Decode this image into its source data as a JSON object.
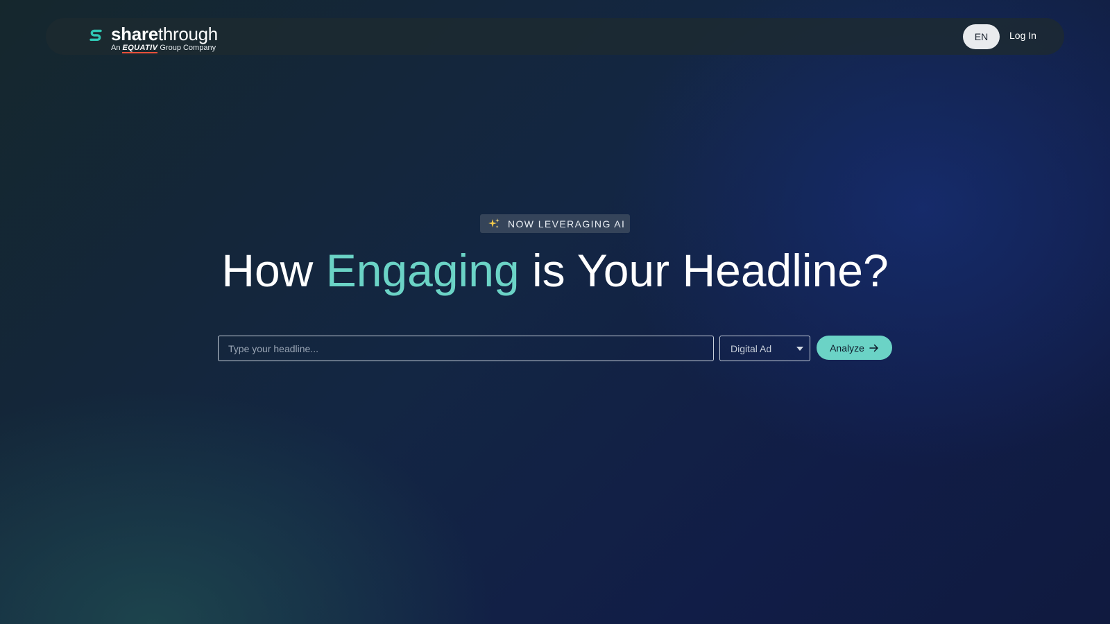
{
  "brand": {
    "name_bold": "share",
    "name_light": "through",
    "tag_prefix": "An",
    "tag_company": "EQUATIV",
    "tag_suffix": "Group Company",
    "logo_icon": "sharethrough-s-icon",
    "accent_color": "#2fc8b4"
  },
  "nav": {
    "language": "EN",
    "login": "Log In"
  },
  "badge": {
    "icon": "sparkles-icon",
    "text": "NOW LEVERAGING AI"
  },
  "hero": {
    "title_before": "How ",
    "title_accent": "Engaging",
    "title_after": " is Your Headline?",
    "accent_color": "#6bd3c6"
  },
  "form": {
    "headline_placeholder": "Type your headline...",
    "headline_value": "",
    "type_selected": "Digital Ad",
    "analyze_label": "Analyze",
    "analyze_icon": "arrow-right-icon"
  }
}
